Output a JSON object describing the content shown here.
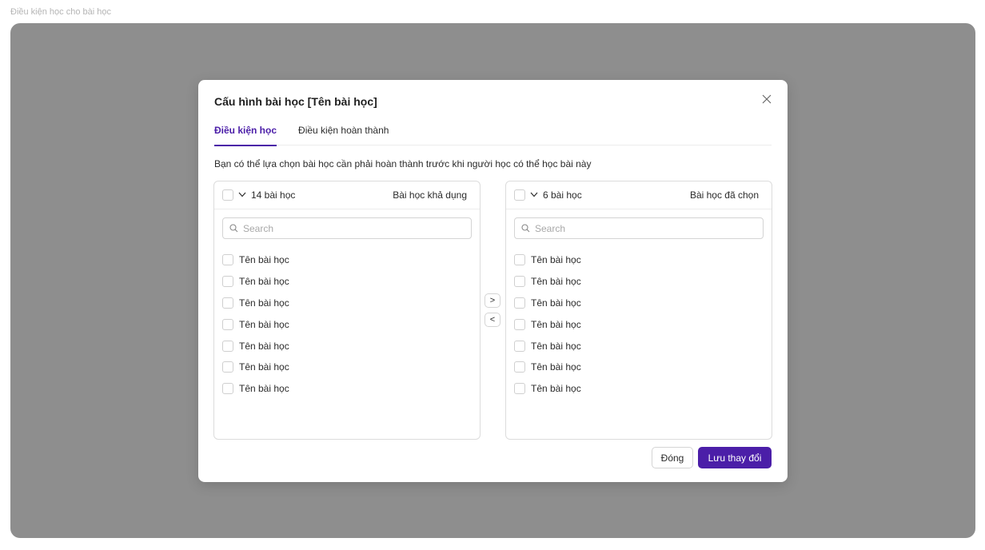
{
  "page": {
    "label": "Điều kiện học cho bài học"
  },
  "modal": {
    "title": "Cấu hình bài học [Tên bài học]",
    "tabs": [
      {
        "label": "Điều kiện học",
        "active": true
      },
      {
        "label": "Điều kiện hoàn thành",
        "active": false
      }
    ],
    "description": "Bạn có thể lựa chọn bài học cần phải hoàn thành trước khi người học có thể học bài này"
  },
  "left_panel": {
    "count": "14 bài học",
    "title": "Bài học khả dụng",
    "search_placeholder": "Search",
    "items": [
      "Tên bài học",
      "Tên bài học",
      "Tên bài học",
      "Tên bài học",
      "Tên bài học",
      "Tên bài học",
      "Tên bài học"
    ]
  },
  "right_panel": {
    "count": "6 bài học",
    "title": "Bài học đã chọn",
    "search_placeholder": "Search",
    "items": [
      "Tên bài học",
      "Tên bài học",
      "Tên bài học",
      "Tên bài học",
      "Tên bài học",
      "Tên bài học",
      "Tên bài học"
    ]
  },
  "transfer": {
    "to_right": ">",
    "to_left": "<"
  },
  "footer": {
    "close_label": "Đóng",
    "save_label": "Lưu thay đổi"
  },
  "colors": {
    "accent": "#4b1ea8",
    "overlay": "#8e8e8e"
  },
  "icons": {
    "close": "close-icon",
    "search": "search-icon",
    "chevron": "chevron-down-icon"
  }
}
